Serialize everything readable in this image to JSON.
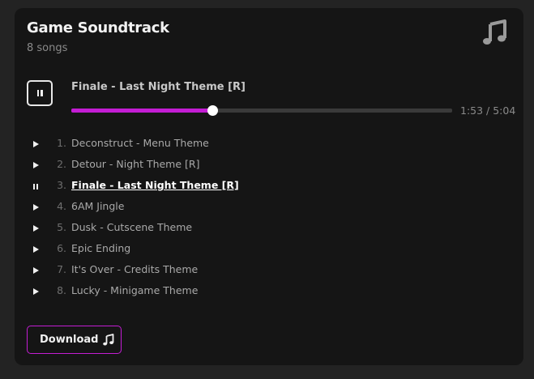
{
  "card": {
    "title": "Game Soundtrack",
    "subtitle": "8 songs",
    "icon": "music-note-icon"
  },
  "player": {
    "state": "playing",
    "button_icon": "pause-icon",
    "now_playing": "Finale - Last Night Theme [R]",
    "elapsed": "1:53",
    "total": "5:04",
    "time_display": "1:53 / 5:04",
    "progress_fraction": 0.37,
    "accent_color": "#c41dd4"
  },
  "tracks": [
    {
      "number": "1.",
      "title": "Deconstruct - Menu Theme",
      "icon": "play-icon",
      "active": false
    },
    {
      "number": "2.",
      "title": "Detour - Night Theme [R]",
      "icon": "play-icon",
      "active": false
    },
    {
      "number": "3.",
      "title": "Finale - Last Night Theme [R]",
      "icon": "pause-icon",
      "active": true
    },
    {
      "number": "4.",
      "title": "6AM Jingle",
      "icon": "play-icon",
      "active": false
    },
    {
      "number": "5.",
      "title": "Dusk - Cutscene Theme",
      "icon": "play-icon",
      "active": false
    },
    {
      "number": "6.",
      "title": "Epic Ending",
      "icon": "play-icon",
      "active": false
    },
    {
      "number": "7.",
      "title": "It's Over - Credits Theme",
      "icon": "play-icon",
      "active": false
    },
    {
      "number": "8.",
      "title": "Lucky - Minigame Theme",
      "icon": "play-icon",
      "active": false
    }
  ],
  "download": {
    "label": "Download",
    "icon": "music-note-icon"
  }
}
